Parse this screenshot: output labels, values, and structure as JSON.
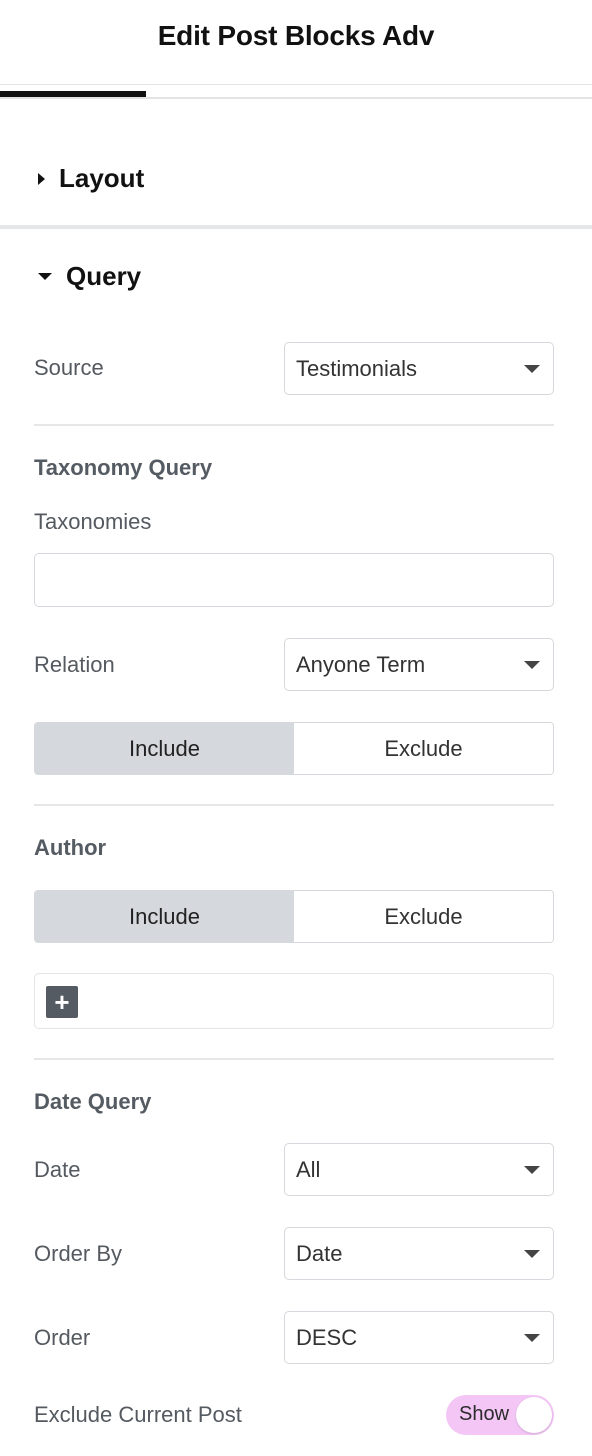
{
  "header": {
    "title": "Edit Post Blocks Adv"
  },
  "sections": {
    "layout": {
      "label": "Layout"
    },
    "query": {
      "label": "Query"
    }
  },
  "query": {
    "source": {
      "label": "Source",
      "value": "Testimonials"
    },
    "taxonomy": {
      "heading": "Taxonomy Query",
      "taxonomies_label": "Taxonomies",
      "taxonomies_value": "",
      "relation": {
        "label": "Relation",
        "value": "Anyone Term"
      },
      "include_label": "Include",
      "exclude_label": "Exclude",
      "active": "Include"
    },
    "author": {
      "heading": "Author",
      "include_label": "Include",
      "exclude_label": "Exclude",
      "active": "Include",
      "add_symbol": "+"
    },
    "date_query": {
      "heading": "Date Query",
      "date": {
        "label": "Date",
        "value": "All"
      },
      "order_by": {
        "label": "Order By",
        "value": "Date"
      },
      "order": {
        "label": "Order",
        "value": "DESC"
      }
    },
    "exclude_current_post": {
      "label": "Exclude Current Post",
      "toggle_text": "Show",
      "on": true
    }
  },
  "colors": {
    "toggle_on": "#f3c6f6",
    "active_segment": "#d5d8dc",
    "heading_grey": "#555b62"
  }
}
